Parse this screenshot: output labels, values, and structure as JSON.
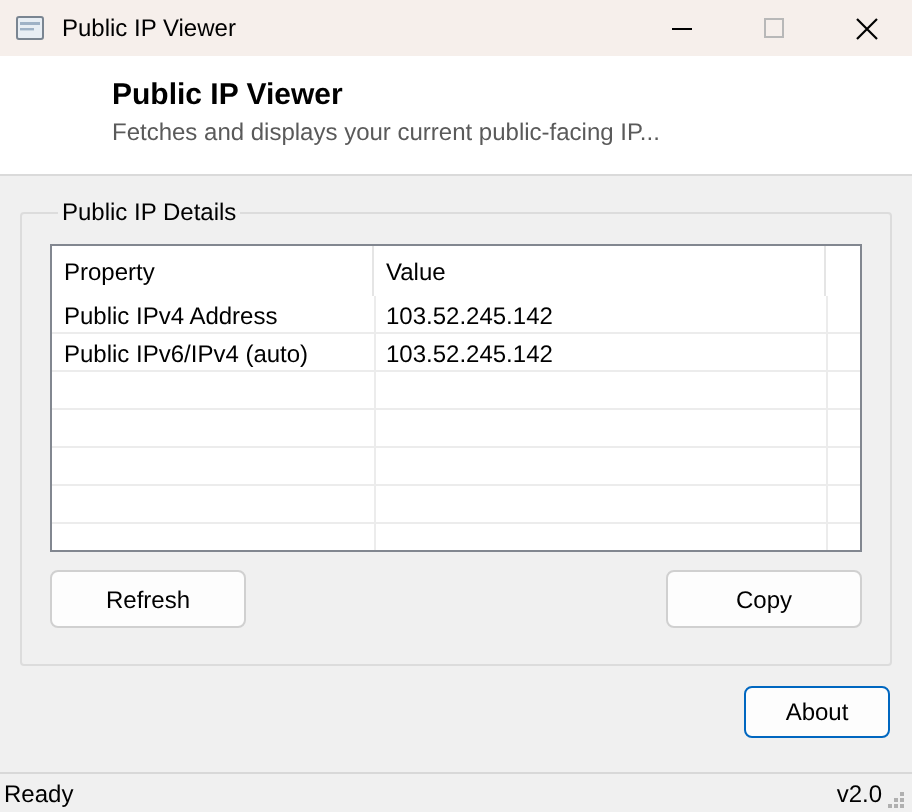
{
  "window": {
    "title": "Public IP Viewer"
  },
  "header": {
    "title": "Public IP Viewer",
    "subtitle": "Fetches and displays your current public-facing IP..."
  },
  "details": {
    "title": "Public IP Details",
    "table": {
      "columns": [
        "Property",
        "Value"
      ],
      "rows": [
        [
          "Public IPv4 Address",
          "103.52.245.142"
        ],
        [
          "Public IPv6/IPv4 (auto)",
          "103.52.245.142"
        ]
      ]
    },
    "buttons": [
      {
        "label": "Refresh",
        "focused": false
      },
      {
        "label": "Copy",
        "focused": false
      }
    ]
  },
  "about_button": {
    "label": "About",
    "focused": true
  },
  "status_bar": {
    "text": "Ready",
    "version": "v2.0"
  }
}
